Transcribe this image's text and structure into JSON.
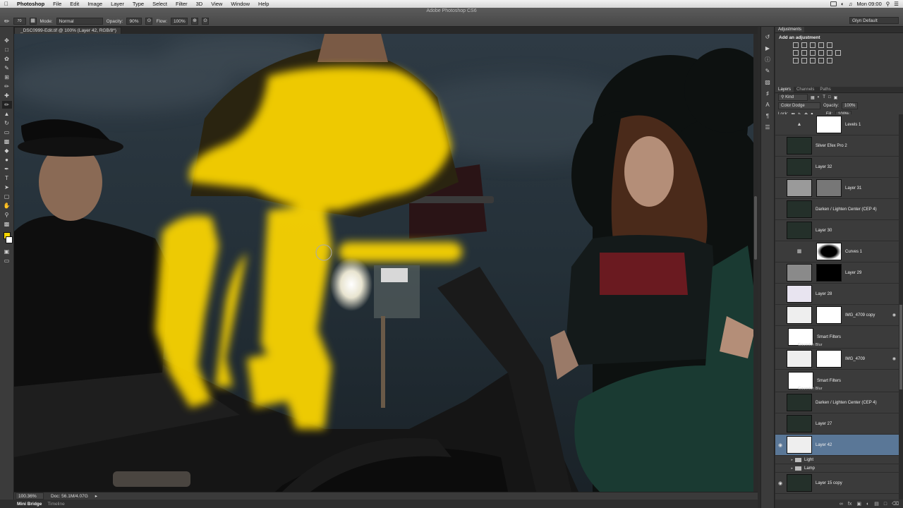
{
  "menubar": {
    "apple": "",
    "app": "Photoshop",
    "items": [
      "File",
      "Edit",
      "Image",
      "Layer",
      "Type",
      "Select",
      "Filter",
      "3D",
      "View",
      "Window",
      "Help"
    ],
    "clock": "Mon 09:00"
  },
  "window_title": "Adobe Photoshop CS6",
  "options": {
    "brush_size": "70",
    "mode_label": "Mode:",
    "mode_value": "Normal",
    "opacity_label": "Opacity:",
    "opacity_value": "90%",
    "flow_label": "Flow:",
    "flow_value": "100%",
    "workspace": "Glyn Default"
  },
  "document_tab": "_DSC0999-Edit.tif @ 100% (Layer 42, RGB/8*)",
  "status": {
    "zoom": "100.36%",
    "doc": "Doc: 56.1M/4.07G"
  },
  "bottom_tabs": [
    "Mini Bridge",
    "Timeline"
  ],
  "adjustments": {
    "tab": "Adjustments",
    "title": "Add an adjustment"
  },
  "layers_panel": {
    "tabs": [
      "Layers",
      "Channels",
      "Paths"
    ],
    "filter": "Kind",
    "blend_mode": "Color Dodge",
    "opacity_label": "Opacity:",
    "opacity_value": "100%",
    "lock_label": "Lock:",
    "fill_label": "Fill:",
    "fill_value": "100%"
  },
  "layers": [
    {
      "name": "Levels 1"
    },
    {
      "name": "Silver Efex Pro 2"
    },
    {
      "name": "Layer 32"
    },
    {
      "name": "Layer 31"
    },
    {
      "name": "Darken / Lighten Center (CEP 4)"
    },
    {
      "name": "Layer 30"
    },
    {
      "name": "Curves 1"
    },
    {
      "name": "Layer 29"
    },
    {
      "name": "Layer 28"
    },
    {
      "name": "IMG_4709 copy"
    },
    {
      "name": "Smart Filters",
      "sub": "Gaussian Blur"
    },
    {
      "name": "IMG_4709"
    },
    {
      "name": "Smart Filters",
      "sub": "Gaussian Blur"
    },
    {
      "name": "Darken / Lighten Center (CEP 4)"
    },
    {
      "name": "Layer 27"
    },
    {
      "name": "Layer 42"
    }
  ],
  "groups": [
    "Light",
    "Lamp"
  ],
  "last_layer": "Layer 15 copy",
  "colors": {
    "foreground": "#f5d400",
    "background": "#ffffff",
    "paint": "#ffd800",
    "selected_layer": "#5a7797"
  }
}
